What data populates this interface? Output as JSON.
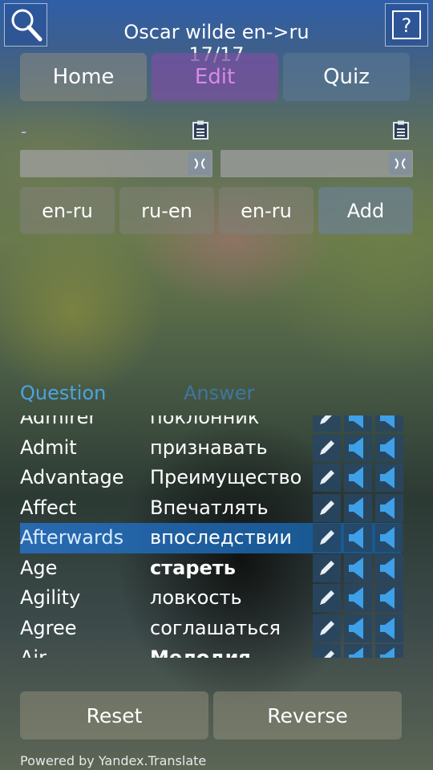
{
  "header": {
    "title": "Oscar wilde en->ru 17/17",
    "search_icon": "search-icon",
    "help_icon": "help-icon"
  },
  "tabs": [
    {
      "label": "Home"
    },
    {
      "label": "Edit",
      "active": true,
      "color": "#d78ae8"
    },
    {
      "label": "Quiz"
    }
  ],
  "editor": {
    "dash": "-",
    "field1_value": "",
    "field2_value": "",
    "buttons": [
      "en-ru",
      "ru-en",
      "en-ru",
      "Add"
    ]
  },
  "table": {
    "question_header": "Question",
    "answer_header": "Answer",
    "rows": [
      {
        "q": "Admirer",
        "a": "поклонник"
      },
      {
        "q": "Admit",
        "a": "признавать"
      },
      {
        "q": "Advantage",
        "a": "Преимущество"
      },
      {
        "q": "Affect",
        "a": "Впечатлять"
      },
      {
        "q": "Afterwards",
        "a": "впоследствии"
      },
      {
        "q": "Age",
        "a": "стареть"
      },
      {
        "q": "Agility",
        "a": "ловкость"
      },
      {
        "q": "Agree",
        "a": "соглашаться"
      },
      {
        "q": "Air",
        "a": "Мелодия"
      }
    ]
  },
  "footer": {
    "reset_label": "Reset",
    "reverse_label": "Reverse",
    "powered_by": "Powered by Yandex.Translate"
  },
  "colors": {
    "accent_blue": "#3ea0e8",
    "question_header": "#4da3e0"
  }
}
